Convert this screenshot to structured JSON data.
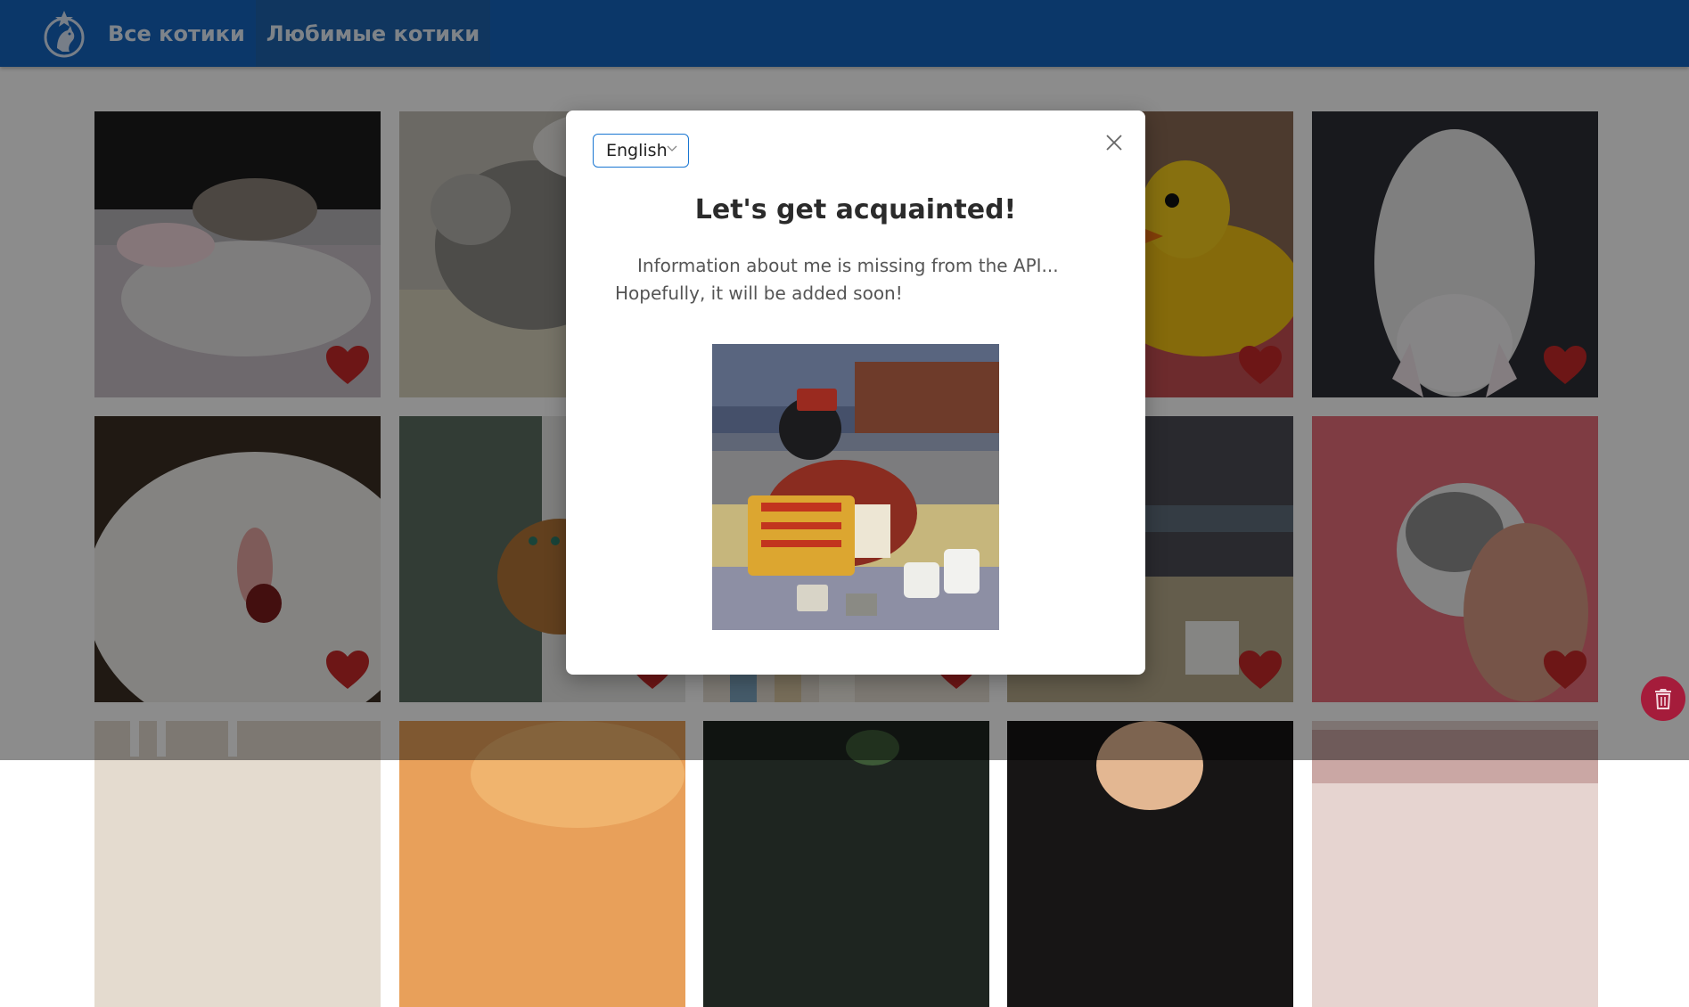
{
  "header": {
    "logo_icon": "cat-medal-logo-icon",
    "nav": [
      {
        "label": "Все котики",
        "active": false
      },
      {
        "label": "Любимые котики",
        "active": true
      }
    ]
  },
  "grid": {
    "tiles": [
      {
        "photo": "white rabbit and kitten sleeping",
        "favorite": true
      },
      {
        "photo": "grey tabby kitten lying on carpet",
        "favorite": true
      },
      {
        "photo": "cat photo (covered by dialog)",
        "favorite": true
      },
      {
        "photo": "rubber duck",
        "favorite": true
      },
      {
        "photo": "white kitten sleeping upside down",
        "favorite": true
      },
      {
        "photo": "white cat close-up yawning",
        "favorite": true
      },
      {
        "photo": "bengal cat in car window",
        "favorite": true
      },
      {
        "photo": "cat near bookshelf",
        "favorite": true
      },
      {
        "photo": "cat with accordion in kitchen",
        "favorite": true
      },
      {
        "photo": "grey kitten held in hand on pink",
        "favorite": true
      }
    ]
  },
  "modal": {
    "language": "English",
    "title": "Let's get acquainted!",
    "text_line1": "Information about me is missing from the API...",
    "text_line2": "Hopefully, it will be added soon!",
    "image": "black cat in bellhop hat playing accordion",
    "close_icon": "close-icon"
  },
  "fab": {
    "icon": "trash-icon"
  },
  "colors": {
    "header": "#1565c0",
    "heart": "#c62828",
    "fab": "#a51c3b",
    "select_border": "#1976d2"
  }
}
